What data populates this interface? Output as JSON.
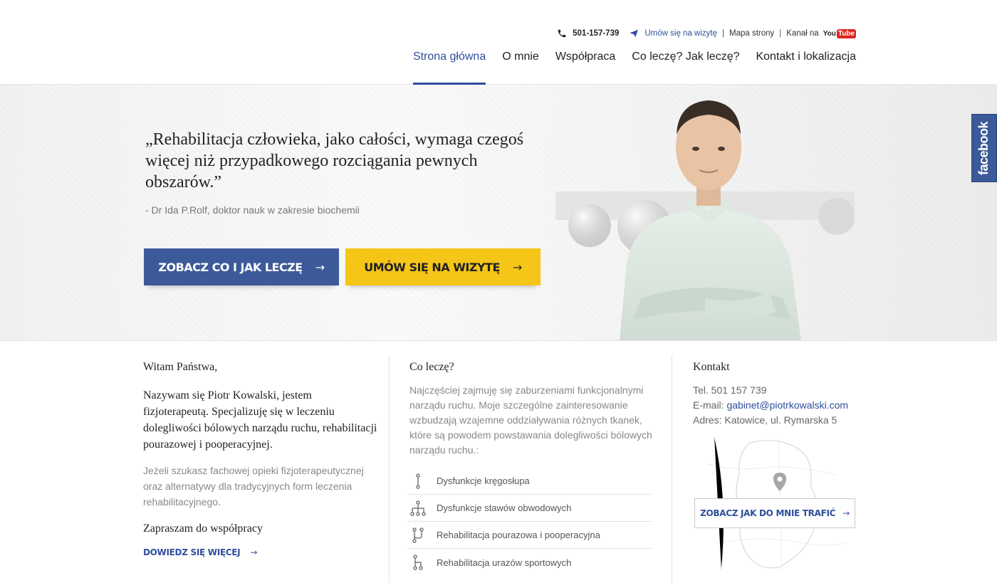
{
  "topbar": {
    "phone": "501-157-739",
    "visit_link": "Umów się na wizytę",
    "sep1": "|",
    "sitemap": "Mapa strony",
    "sep2": "|",
    "channel": "Kanał na",
    "youtube_you": "You",
    "youtube_tube": "Tube"
  },
  "nav": {
    "items": [
      {
        "label": "Strona główna"
      },
      {
        "label": "O mnie"
      },
      {
        "label": "Współpraca"
      },
      {
        "label": "Co leczę? Jak leczę?"
      },
      {
        "label": "Kontakt i lokalizacja"
      }
    ]
  },
  "hero": {
    "quote": "„Rehabilitacja człowieka, jako całości, wymaga czegoś więcej niż przypadkowego rozciągania pewnych obszarów.”",
    "author": "- Dr Ida P.Rolf, doktor nauk w zakresie biochemii",
    "btn_primary": "ZOBACZ CO I JAK LECZĘ",
    "btn_secondary": "UMÓW SIĘ NA WIZYTĘ",
    "arrow": "→",
    "facebook": "facebook"
  },
  "welcome": {
    "title": "Witam Państwa,",
    "lead": "Nazywam się Piotr Kowalski, jestem fizjoterapeutą.  Specjalizuję się w leczeniu dolegliwości bólowych narządu ruchu, rehabilitacji pourazowej i pooperacyjnej.",
    "text": "Jeżeli szukasz fachowej opieki fizjoterapeutycznej oraz alternatywy dla tradycyjnych form leczenia rehabilitacyjnego.",
    "invite": "Zapraszam do współpracy",
    "more": "DOWIEDZ SIĘ WIĘCEJ"
  },
  "treat": {
    "title": "Co leczę?",
    "desc": "Najczęściej zajmuję się zaburzeniami funkcjonalnymi narządu ruchu. Moje szczególne zainteresowanie wzbudzają wzajemne oddziaływania różnych tkanek, które są powodem powstawania dolegliwości bólowych narządu ruchu.:",
    "items": [
      {
        "label": "Dysfunkcje kręgosłupa",
        "icon": "spine-icon"
      },
      {
        "label": "Dysfunkcje stawów obwodowych",
        "icon": "joints-icon"
      },
      {
        "label": "Rehabilitacja pourazowa i pooperacyjna",
        "icon": "recovery-icon"
      },
      {
        "label": "Rehabilitacja urazów sportowych",
        "icon": "sport-icon"
      }
    ]
  },
  "contact": {
    "title": "Kontakt",
    "tel": "Tel. 501 157 739",
    "email_label": "E-mail: ",
    "email": "gabinet@piotrkowalski.com",
    "address": "Adres: Katowice, ul. Rymarska 5",
    "map_button": "ZOBACZ JAK DO MNIE TRAFIĆ"
  },
  "colors": {
    "brand_blue": "#3c5a99",
    "accent_yellow": "#f5c518",
    "link_blue": "#2e4f9a",
    "facebook_blue": "#3b5a99"
  }
}
